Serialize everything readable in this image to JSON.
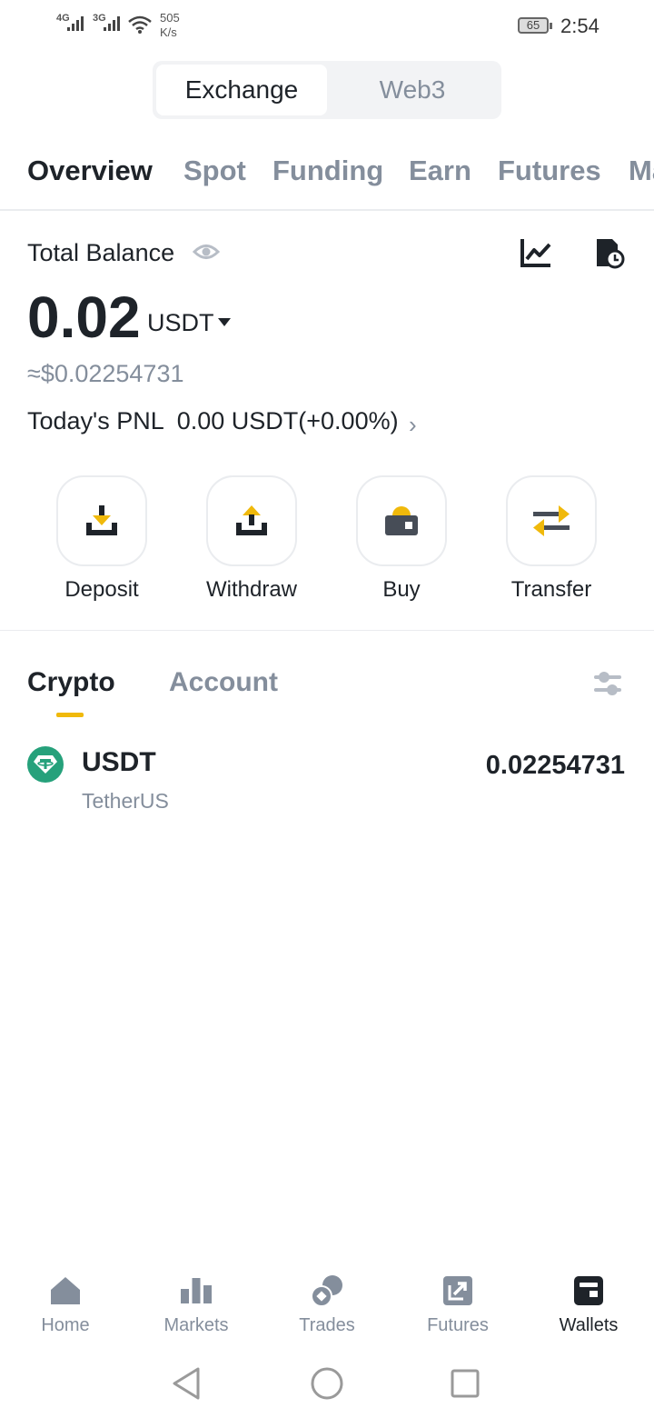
{
  "status_bar": {
    "signal1": "4G",
    "signal2": "3G",
    "net_speed_value": "505",
    "net_speed_unit": "K/s",
    "battery": "65",
    "time": "2:54"
  },
  "segment": {
    "active": "Exchange",
    "inactive": "Web3"
  },
  "tabs": [
    "Overview",
    "Spot",
    "Funding",
    "Earn",
    "Futures",
    "Margin"
  ],
  "balance": {
    "label": "Total Balance",
    "amount": "0.02",
    "unit": "USDT",
    "fiat": "≈$0.02254731",
    "pnl": "Today's PNL  0.00 USDT(+0.00%)"
  },
  "actions": [
    {
      "label": "Deposit",
      "icon": "deposit-icon"
    },
    {
      "label": "Withdraw",
      "icon": "withdraw-icon"
    },
    {
      "label": "Buy",
      "icon": "buy-wallet-icon"
    },
    {
      "label": "Transfer",
      "icon": "transfer-icon"
    }
  ],
  "asset_tabs": {
    "active": "Crypto",
    "inactive": "Account"
  },
  "assets": [
    {
      "symbol": "USDT",
      "name": "TetherUS",
      "amount": "0.02254731"
    }
  ],
  "bottom_nav": [
    {
      "label": "Home",
      "icon": "home-icon"
    },
    {
      "label": "Markets",
      "icon": "markets-icon"
    },
    {
      "label": "Trades",
      "icon": "trades-icon"
    },
    {
      "label": "Futures",
      "icon": "futures-icon"
    },
    {
      "label": "Wallets",
      "icon": "wallets-icon"
    }
  ],
  "colors": {
    "accent": "#f0b90b",
    "text_primary": "#1e2329",
    "text_secondary": "#848e9c",
    "tether": "#26a17b"
  }
}
